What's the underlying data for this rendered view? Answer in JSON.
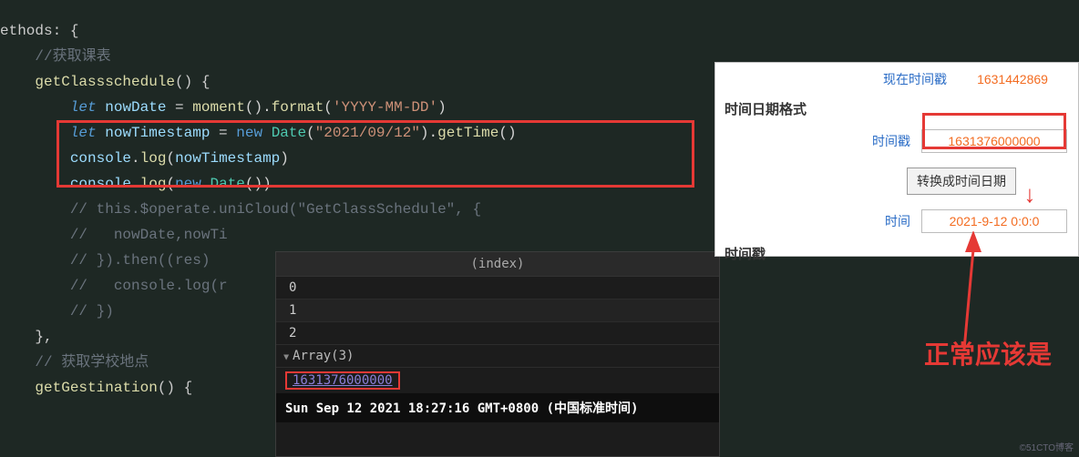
{
  "code": {
    "l1": "ethods: {",
    "l2": "    //获取课表",
    "l3a": "    ",
    "l3b": "getClassschedule",
    "l3c": "() {",
    "l4a": "        ",
    "l4let": "let",
    "l4sp": " ",
    "l4v": "nowDate",
    "l4eq": " = ",
    "l4fn1": "moment",
    "l4p1": "().",
    "l4fn2": "format",
    "l4p2": "(",
    "l4s": "'YYYY-MM-DD'",
    "l4p3": ")",
    "l5a": "        ",
    "l5let": "let",
    "l5sp": " ",
    "l5v": "nowTimestamp",
    "l5eq": " = ",
    "l5new": "new",
    "l5sp2": " ",
    "l5cls": "Date",
    "l5p1": "(",
    "l5s": "\"2021/09/12\"",
    "l5p2": ").",
    "l5fn": "getTime",
    "l5p3": "()",
    "l6a": "        ",
    "l6o": "console",
    "l6d": ".",
    "l6fn": "log",
    "l6p1": "(",
    "l6v": "nowTimestamp",
    "l6p2": ")",
    "l7a": "        ",
    "l7o": "console",
    "l7d": ".",
    "l7fn": "log",
    "l7p1": "(",
    "l7new": "new",
    "l7sp": " ",
    "l7cls": "Date",
    "l7p2": "())",
    "l8": "        // this.$operate.uniCloud(\"GetClassSchedule\", {",
    "l9": "        //   nowDate,nowTi",
    "l10": "        // }).then((res) ",
    "l11": "        //   console.log(r",
    "l12": "        // })",
    "l13": "    },",
    "l14": "    // 获取学校地点",
    "l15a": "    ",
    "l15b": "getGestination",
    "l15c": "() {"
  },
  "devtools": {
    "head": "(index)",
    "rows": [
      "0",
      "1",
      "2"
    ],
    "array": "Array(3)",
    "timestamp": "1631376000000",
    "date": "Sun Sep 12 2021 18:27:16 GMT+0800 (中国标准时间)"
  },
  "panel": {
    "now_label": "现在时间戳",
    "now_value": "1631442869",
    "heading1": "时间日期格式",
    "ts_label": "时间戳",
    "ts_value": "1631376000000",
    "convert_btn": "转换成时间日期",
    "time_label": "时间",
    "time_value": "2021-9-12 0:0:0",
    "heading2": "时间戳"
  },
  "annotation": "正常应该是",
  "watermark": "©51CTO博客"
}
